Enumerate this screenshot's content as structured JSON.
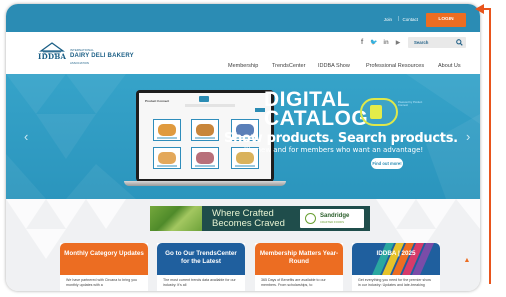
{
  "topbar": {
    "join_label": "Join",
    "separator": "|",
    "contact_label": "Contact",
    "login_label": "LOGIN"
  },
  "header": {
    "logo": {
      "abbrev": "IDDBA",
      "intl": "INTERNATIONAL",
      "name": "DAIRY DELI BAKERY",
      "assoc": "ASSOCIATION"
    },
    "socials": [
      {
        "icon": "facebook-icon",
        "glyph": "f"
      },
      {
        "icon": "twitter-icon",
        "glyph": "🐦"
      },
      {
        "icon": "linkedin-icon",
        "glyph": "in"
      },
      {
        "icon": "youtube-icon",
        "glyph": "▶"
      }
    ],
    "search_placeholder": "Search",
    "nav": [
      "Membership",
      "TrendsCenter",
      "IDDBA Show",
      "Professional Resources",
      "About Us"
    ]
  },
  "hero": {
    "title_line1": "DIGITAL",
    "title_line2": "CATALOG",
    "badge_note": "Powered by Product Connect",
    "tagline": "Show products. Search products.",
    "subline": "It's new and for members who want an advantage!",
    "cta_label": "Find out more!",
    "catalog_header": "Product Connect"
  },
  "ad": {
    "line1": "Where Crafted",
    "line2": "Becomes Craved",
    "brand": "Sandridge",
    "brand_sub": "CRAFTED FOODS"
  },
  "cards": [
    {
      "title": "Monthly Category Updates",
      "body": "We have partnered with Circana to bring you monthly updates with a",
      "color": "#ec6d22"
    },
    {
      "title": "Go to Our TrendsCenter for the Latest",
      "body": "The most current trends data available for our industry. It's all",
      "color": "#1f5f9e"
    },
    {
      "title": "Membership Matters Year-Round",
      "body": "365 Days of Benefits are available to our members. From scholarships, to",
      "color": "#ec6d22"
    },
    {
      "title": "IDDBA | 2025",
      "body": "Get everything you need for the premier show in our industry: Updates and late-breaking",
      "color": "#1f5f9e"
    }
  ],
  "colors": {
    "brand_blue": "#2b8cb4",
    "accent_orange": "#ec6d22",
    "navy": "#1f5f9e"
  }
}
